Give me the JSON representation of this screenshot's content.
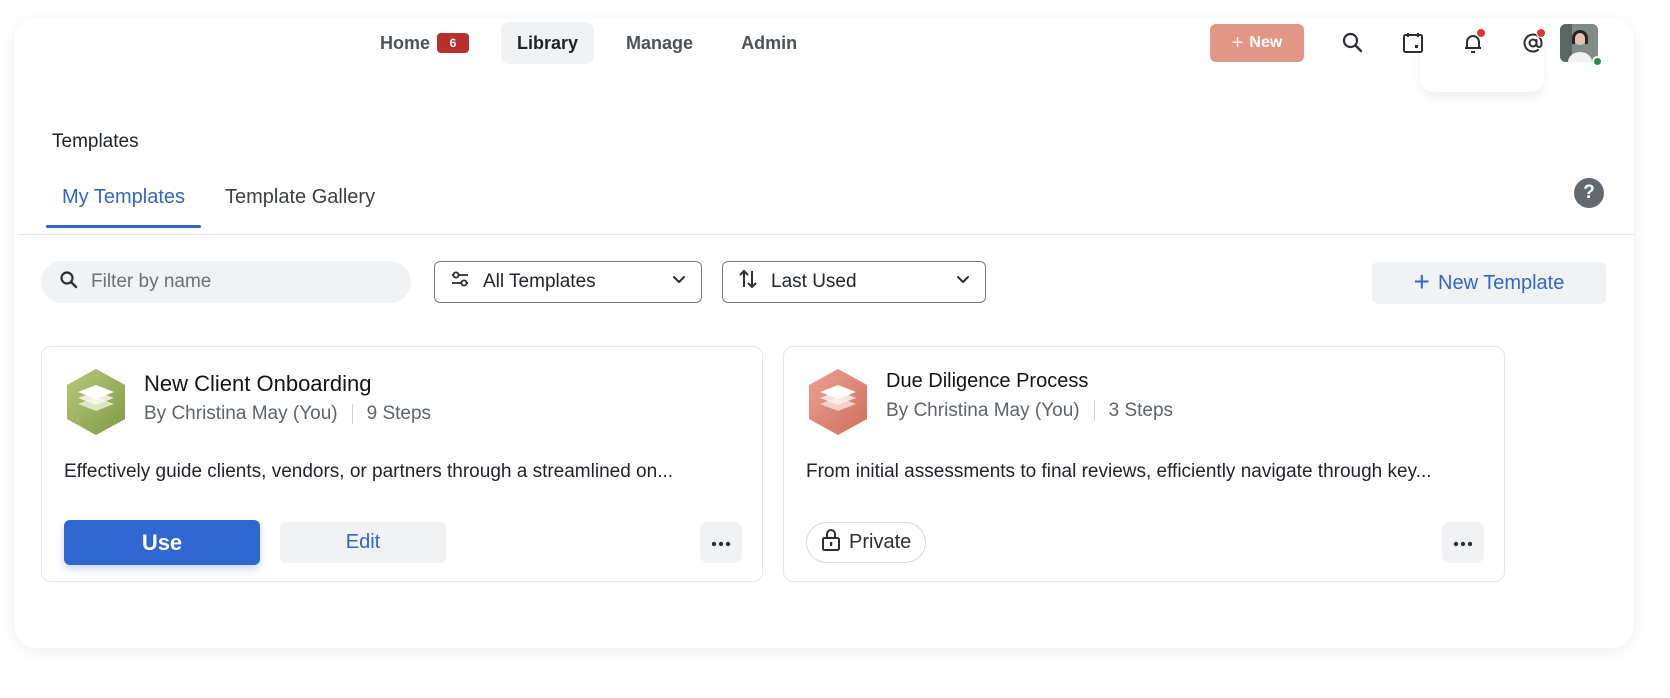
{
  "nav": {
    "items": [
      {
        "label": "Home",
        "badge": "6"
      },
      {
        "label": "Library"
      },
      {
        "label": "Manage"
      },
      {
        "label": "Admin"
      }
    ],
    "new_label": "New",
    "icons": [
      "search-icon",
      "calendar-icon",
      "bell-icon",
      "mention-icon"
    ]
  },
  "page": {
    "title": "Templates",
    "tabs": [
      {
        "label": "My Templates"
      },
      {
        "label": "Template Gallery"
      }
    ],
    "help_label": "?"
  },
  "filters": {
    "search_placeholder": "Filter by name",
    "type_value": "All Templates",
    "sort_value": "Last Used",
    "new_template_label": "New Template"
  },
  "cards": [
    {
      "title": "New Client Onboarding",
      "author": "By Christina May (You)",
      "steps": "9 Steps",
      "description": "Effectively guide clients, vendors, or partners through a streamlined on...",
      "use_label": "Use",
      "edit_label": "Edit",
      "icon_color": "#9bb25f"
    },
    {
      "title": "Due Diligence Process",
      "author": "By Christina May (You)",
      "steps": "3 Steps",
      "description": "From initial assessments to final reviews, efficiently navigate through key...",
      "private_label": "Private",
      "icon_color": "#e08a79"
    }
  ],
  "colors": {
    "accent": "#3066c9",
    "primary_button": "#2f66d0",
    "new_button": "#e39685",
    "badge": "#b8302c"
  }
}
